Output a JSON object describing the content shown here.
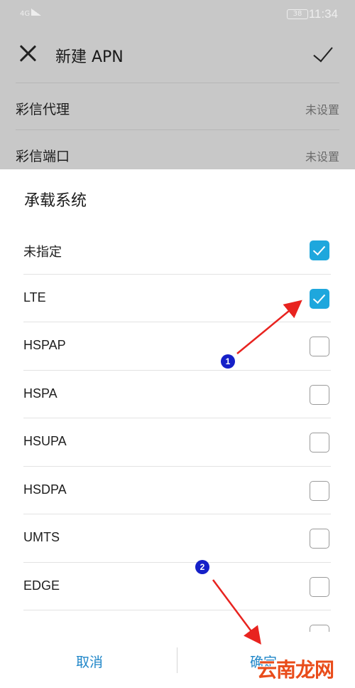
{
  "status_bar": {
    "network": "4G",
    "battery": "38",
    "time": "11:34"
  },
  "app_bar": {
    "title": "新建 APN"
  },
  "background_rows": [
    {
      "label": "彩信代理",
      "value": "未设置"
    },
    {
      "label": "彩信端口",
      "value": "未设置"
    }
  ],
  "dialog": {
    "title": "承载系统",
    "options": [
      {
        "label": "未指定",
        "checked": true
      },
      {
        "label": "LTE",
        "checked": true
      },
      {
        "label": "HSPAP",
        "checked": false
      },
      {
        "label": "HSPA",
        "checked": false
      },
      {
        "label": "HSUPA",
        "checked": false
      },
      {
        "label": "HSDPA",
        "checked": false
      },
      {
        "label": "UMTS",
        "checked": false
      },
      {
        "label": "EDGE",
        "checked": false
      }
    ],
    "cancel_label": "取消",
    "confirm_label": "确定"
  },
  "annotations": {
    "badge_1": "1",
    "badge_2": "2",
    "arrow_color": "#e8231f",
    "watermark": "云南龙网"
  },
  "colors": {
    "accent": "#1ea7dd",
    "button_text": "#1f86c8"
  }
}
